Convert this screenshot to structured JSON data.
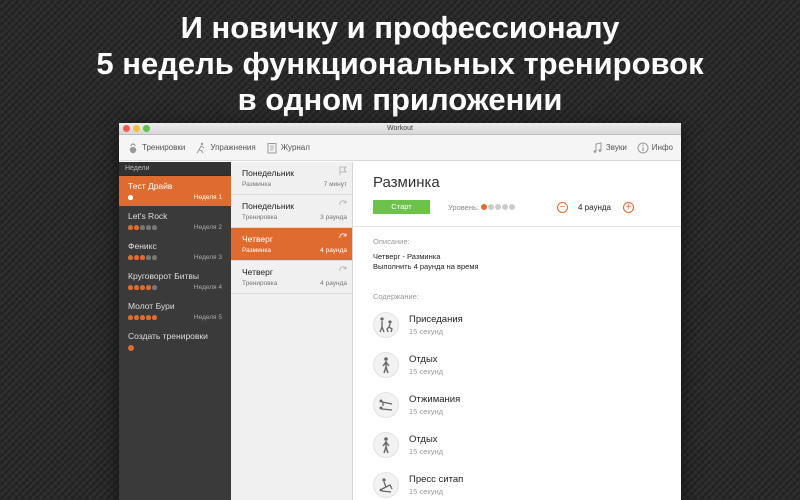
{
  "headline": [
    "И новичку и профессионалу",
    "5 недель функциональных тренировок",
    "в одном приложении"
  ],
  "window": {
    "title": "Workout"
  },
  "toolbar": {
    "workouts": "Тренировки",
    "exercises": "Упражнения",
    "journal": "Журнал",
    "sounds": "Звуки",
    "info": "Инфо"
  },
  "weeks": {
    "header": "Недели",
    "items": [
      {
        "name": "Тест Драйв",
        "week": "Неделя 1"
      },
      {
        "name": "Let's Rock",
        "week": "Неделя 2"
      },
      {
        "name": "Феникс",
        "week": "Неделя 3"
      },
      {
        "name": "Круговорот Битвы",
        "week": "Неделя 4"
      },
      {
        "name": "Молот Бури",
        "week": "Неделя 5"
      }
    ],
    "create": "Создать тренировки"
  },
  "days": [
    {
      "name": "Понедельник",
      "type": "Разминка",
      "meta": "7 минут"
    },
    {
      "name": "Понедельник",
      "type": "Тренировка",
      "meta": "3 раунда"
    },
    {
      "name": "Четверг",
      "type": "Разминка",
      "meta": "4 раунда"
    },
    {
      "name": "Четверг",
      "type": "Тренировка",
      "meta": "4 раунда"
    }
  ],
  "detail": {
    "title": "Разминка",
    "start": "Старт",
    "level_label": "Уровень:",
    "rounds": "4 раунда",
    "description_label": "Описание:",
    "description": [
      "Четверг - Разминка",
      "Выполнить 4 раунда на время"
    ],
    "content_label": "Содержание:",
    "exercises": [
      {
        "name": "Приседания",
        "duration": "15 секунд"
      },
      {
        "name": "Отдых",
        "duration": "15 секунд"
      },
      {
        "name": "Отжимания",
        "duration": "15 секунд"
      },
      {
        "name": "Отдых",
        "duration": "15 секунд"
      },
      {
        "name": "Пресс ситап",
        "duration": "15 секунд"
      }
    ]
  },
  "colors": {
    "accent": "#e06b2f",
    "start": "#6cc24a",
    "sidebar": "#3a3a3a"
  }
}
